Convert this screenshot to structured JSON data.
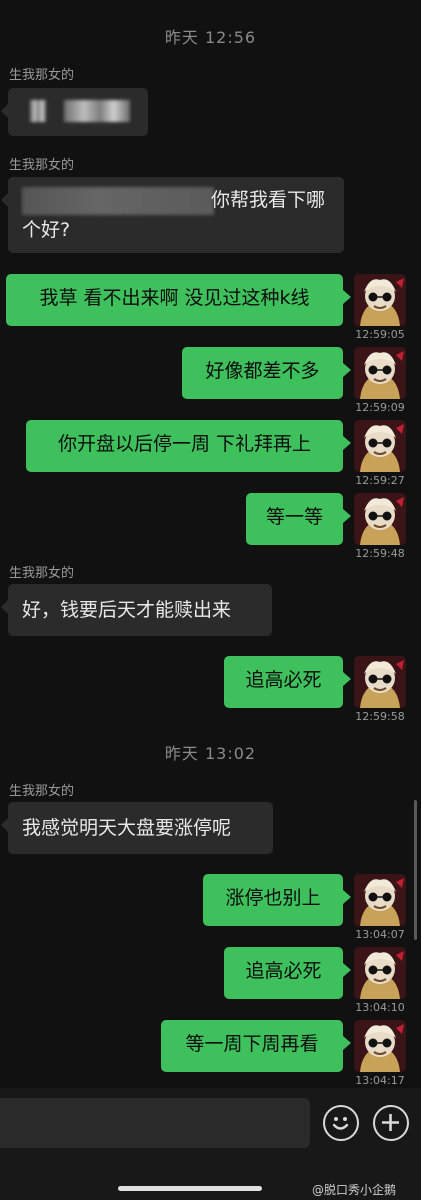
{
  "timestamps": [
    "昨天 12:56",
    "昨天 13:02"
  ],
  "contact_name": "生我那女的",
  "messages": [
    {
      "dir": "in",
      "text": "",
      "blurred": true
    },
    {
      "dir": "in",
      "text_line1_visible": "你帮我看下哪",
      "text_line2": "个好?",
      "blurred": true
    },
    {
      "dir": "out",
      "text": "我草 看不出来啊 没见过这种k线",
      "time": "12:59:05"
    },
    {
      "dir": "out",
      "text": "好像都差不多",
      "time": "12:59:09"
    },
    {
      "dir": "out",
      "text": "你开盘以后停一周 下礼拜再上",
      "time": "12:59:27"
    },
    {
      "dir": "out",
      "text": "等一等",
      "time": "12:59:48"
    },
    {
      "dir": "in",
      "text": "好，钱要后天才能赎出来"
    },
    {
      "dir": "out",
      "text": "追高必死",
      "time": "12:59:58"
    },
    {
      "dir": "in",
      "text": "我感觉明天大盘要涨停呢"
    },
    {
      "dir": "out",
      "text": "涨停也别上",
      "time": "13:04:07"
    },
    {
      "dir": "out",
      "text": "追高必死",
      "time": "13:04:10"
    },
    {
      "dir": "out",
      "text": "等一周下周再看",
      "time": "13:04:17"
    }
  ],
  "input_bar": {
    "emoji_icon": "emoji-icon",
    "plus_icon": "plus-icon"
  },
  "watermark": "@脱口秀小企鹅",
  "colors": {
    "outgoing": "#3ec15c",
    "incoming": "#2b2b2b",
    "background": "#111111"
  }
}
